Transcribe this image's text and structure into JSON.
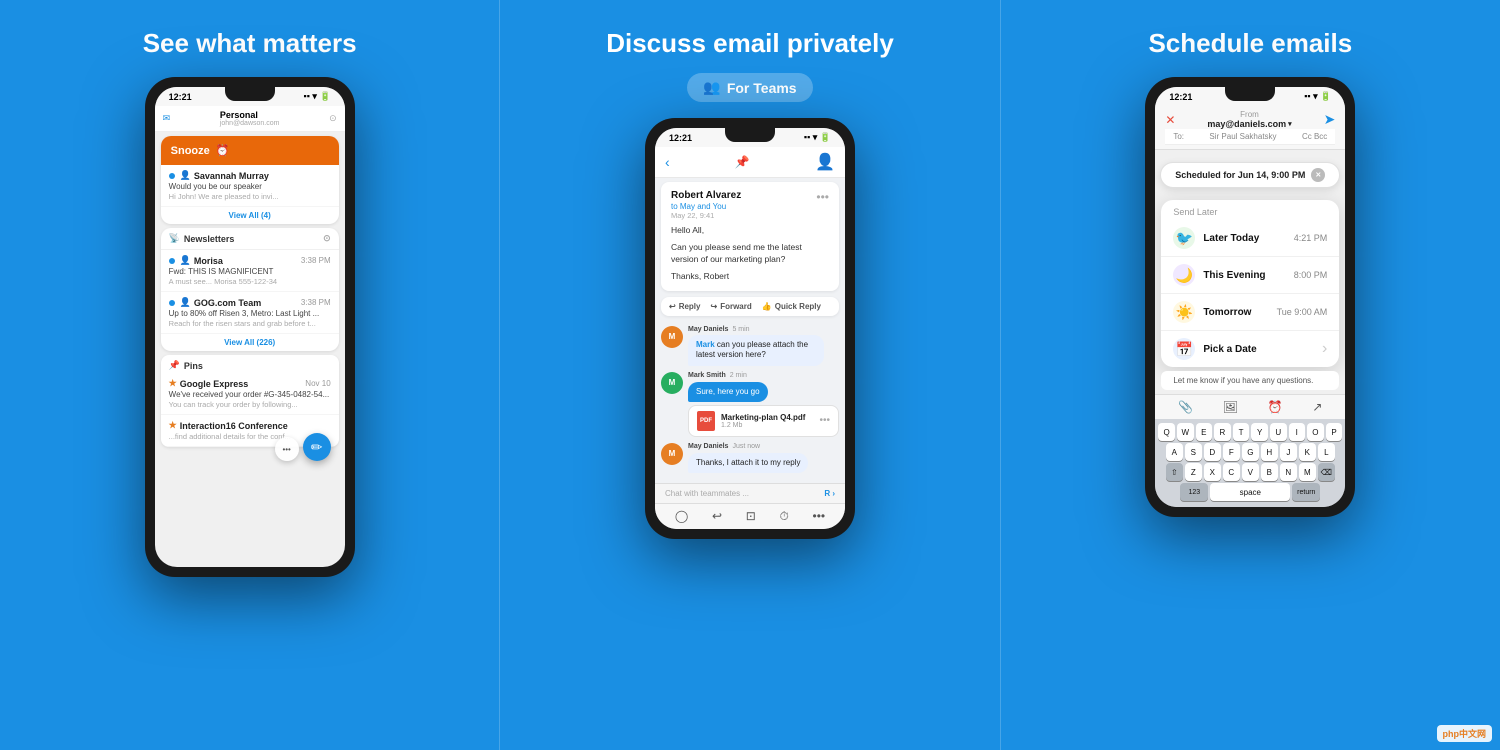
{
  "panel1": {
    "title": "See what matters",
    "status_time": "12:21",
    "account": {
      "label": "Personal",
      "email": "john@dawson.com"
    },
    "snooze": {
      "label": "Snooze"
    },
    "emails": [
      {
        "sender": "Savannah Murray",
        "subject": "Would you be our speaker",
        "preview": "Hi John! We are pleased to invi...",
        "time": ""
      }
    ],
    "view_all_1": "View All (4)",
    "newsletters_label": "Newsletters",
    "newsletters_email": {
      "sender": "GOG.com Team",
      "time": "3:38 PM",
      "subject": "Up to 80% off Risen 3, Metro: Last Light ...",
      "preview": "Reach for the risen stars and grab before t..."
    },
    "morisa": {
      "sender": "Morisa",
      "time": "3:38 PM",
      "subject": "Fwd: THIS IS MAGNIFICENT",
      "preview": "A must see... Morisa 555-122-34"
    },
    "view_all_2": "View All (226)",
    "pins_label": "Pins",
    "pin1": {
      "sender": "Google Express",
      "time": "Nov 10",
      "subject": "We've received your order #G-345-0482-54...",
      "preview": "You can track your order by following..."
    },
    "pin2": {
      "sender": "Interaction16 Conference",
      "subject": "...find additional details for the conf..."
    }
  },
  "panel2": {
    "title": "Discuss email privately",
    "for_teams_label": "For Teams",
    "status_time": "12:21",
    "thread": {
      "sender": "Robert Alvarez",
      "to": "to May and You",
      "date": "May 22, 9:41",
      "greeting": "Hello All,",
      "body": "Can you please send me the latest version of our marketing plan?",
      "sign": "Thanks, Robert"
    },
    "actions": {
      "reply": "Reply",
      "forward": "Forward",
      "quick_reply": "Quick Reply"
    },
    "messages": [
      {
        "sender": "May Daniels",
        "time": "5 min",
        "text": "Mark can you please attach the latest version here?",
        "bubble_color": "blue",
        "avatar_color": "#e67e22",
        "avatar_letter": "M"
      },
      {
        "sender": "Mark Smith",
        "time": "2 min",
        "text": "Sure, here you go",
        "bubble_color": "gray",
        "avatar_color": "#27ae60",
        "avatar_letter": "M"
      }
    ],
    "attachment": {
      "name": "Marketing-plan Q4.pdf",
      "size": "1.2 Mb"
    },
    "message3": {
      "sender": "May Daniels",
      "time": "Just now",
      "text": "Thanks, I attach it to my reply",
      "avatar_color": "#e67e22",
      "avatar_letter": "M"
    },
    "chat_placeholder": "Chat with teammates ..."
  },
  "panel3": {
    "title": "Schedule emails",
    "status_time": "12:21",
    "compose": {
      "from_label": "From",
      "from_email": "may@daniels.com",
      "to_label": "To:",
      "to_value": "Sir Paul Sakhatsky",
      "cc_label": "Cc Bcc"
    },
    "scheduled_badge": "Scheduled for Jun 14, 9:00 PM",
    "send_later_label": "Send Later",
    "options": [
      {
        "label": "Later Today",
        "time": "4:21 PM",
        "icon": "🐦",
        "icon_bg": "#e8f8e8"
      },
      {
        "label": "This Evening",
        "time": "8:00 PM",
        "icon": "🌙",
        "icon_bg": "#f0e8ff"
      },
      {
        "label": "Tomorrow",
        "time": "Tue 9:00 AM",
        "icon": "☀️",
        "icon_bg": "#fff8e0"
      },
      {
        "label": "Pick a Date",
        "time": "",
        "icon": "📅",
        "icon_bg": "#e8f0fe"
      }
    ],
    "body_text": "Let me know if you have any questions.",
    "keyboard": {
      "rows": [
        [
          "Q",
          "W",
          "E",
          "R",
          "T",
          "Y",
          "U",
          "I",
          "O",
          "P"
        ],
        [
          "A",
          "S",
          "D",
          "F",
          "G",
          "H",
          "J",
          "K",
          "L"
        ],
        [
          "⇧",
          "Z",
          "X",
          "C",
          "V",
          "B",
          "N",
          "M",
          "⌫"
        ],
        [
          "123",
          "space",
          "return"
        ]
      ]
    }
  },
  "watermark": "php中文网"
}
